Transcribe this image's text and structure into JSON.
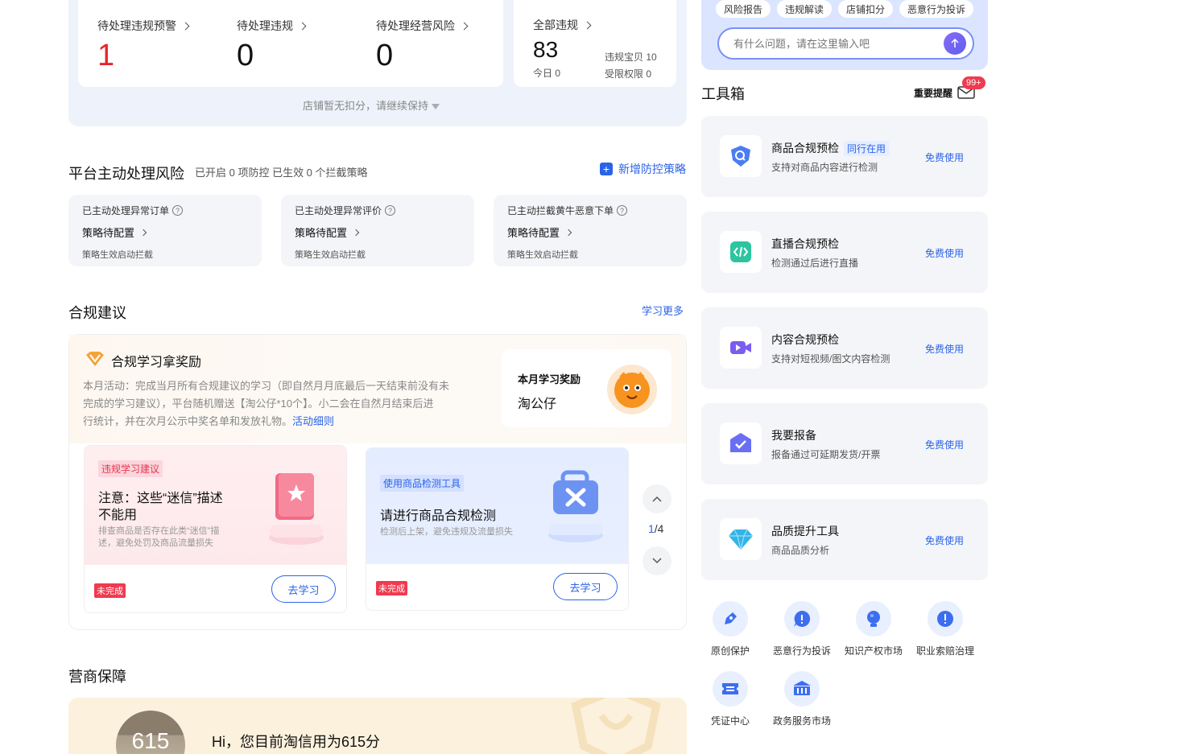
{
  "stats": {
    "pending_warning": {
      "label": "待处理违规预警",
      "value": "1"
    },
    "pending_violation": {
      "label": "待处理违规",
      "value": "0"
    },
    "pending_risk": {
      "label": "待处理经营风险",
      "value": "0"
    },
    "all": {
      "label": "全部违规",
      "value": "83",
      "today": "今日 0",
      "item_violation": "违规宝贝 10",
      "rights_restricted": "受限权限 0"
    },
    "hint": "店铺暂无扣分，请继续保持"
  },
  "risk_section": {
    "title": "平台主动处理风险",
    "subtitle": "已开启 0 项防控 已生效 0 个拦截策略",
    "add_link": "新增防控策略",
    "cards": [
      {
        "title": "已主动处理异常订单",
        "status": "策略待配置",
        "desc": "策略生效启动拦截"
      },
      {
        "title": "已主动处理异常评价",
        "status": "策略待配置",
        "desc": "策略生效启动拦截"
      },
      {
        "title": "已主动拦截黄牛恶意下单",
        "status": "策略待配置",
        "desc": "策略生效启动拦截"
      }
    ]
  },
  "compliance": {
    "title": "合规建议",
    "more_link": "学习更多",
    "reward_title": "合规学习拿奖励",
    "reward_desc_1": "本月活动：完成当月所有合规建议的学习（即自然月月底最后一天结束前没有未",
    "reward_desc_2": "完成的学习建议），平台随机赠送【淘公仔*10个】。小二会在自然月结束后进",
    "reward_desc_3": "行统计，并在次月公示中奖名单和发放礼物。",
    "reward_detail_link": "活动细则",
    "monthly_reward_label": "本月学习奖励",
    "monthly_reward_item": "淘公仔",
    "cards": [
      {
        "tag": "违规学习建议",
        "title_1": "注意：这些“迷信”描述",
        "title_2": "不能用",
        "desc_1": "排查商品是否存在此类“迷信”描",
        "desc_2": "述，避免处罚及商品流量损失",
        "badge": "未完成",
        "button": "去学习"
      },
      {
        "tag": "使用商品检测工具",
        "title_1": "请进行商品合规检测",
        "title_2": "",
        "desc_1": "检测后上架，避免违规及流量损失",
        "desc_2": "",
        "badge": "未完成",
        "button": "去学习"
      }
    ],
    "pager": {
      "current": "1",
      "total": "/4"
    }
  },
  "guarantee": {
    "title": "营商保障",
    "score": "615",
    "greeting": "Hi，您目前淘信用为615分"
  },
  "assistant": {
    "chips": [
      "风险报告",
      "违规解读",
      "店铺扣分",
      "恶意行为投诉"
    ],
    "input_placeholder": "有什么问题，请在这里输入吧"
  },
  "toolbox": {
    "title": "工具箱",
    "reminder_label": "重要提醒",
    "reminder_badge": "99+",
    "tools": [
      {
        "name": "商品合规预检",
        "tag": "同行在用",
        "desc": "支持对商品内容进行检测",
        "action": "免费使用",
        "icon": "shield-search-icon"
      },
      {
        "name": "直播合规预检",
        "tag": "",
        "desc": "检测通过后进行直播",
        "action": "免费使用",
        "icon": "code-icon"
      },
      {
        "name": "内容合规预检",
        "tag": "",
        "desc": "支持对短视频/图文内容检测",
        "action": "免费使用",
        "icon": "video-icon"
      },
      {
        "name": "我要报备",
        "tag": "",
        "desc": "报备通过可延期发货/开票",
        "action": "免费使用",
        "icon": "check-box-icon"
      },
      {
        "name": "品质提升工具",
        "tag": "",
        "desc": "商品品质分析",
        "action": "免费使用",
        "icon": "diamond-icon"
      }
    ],
    "quick": [
      {
        "label": "原创保护",
        "icon": "pen-icon"
      },
      {
        "label": "恶意行为投诉",
        "icon": "alert-icon"
      },
      {
        "label": "知识产权市场",
        "icon": "bulb-icon"
      },
      {
        "label": "职业索赔治理",
        "icon": "alert-icon"
      },
      {
        "label": "凭证中心",
        "icon": "ticket-icon"
      },
      {
        "label": "政务服务市场",
        "icon": "bank-icon"
      }
    ]
  },
  "colors": {
    "accent": "#2b63e8",
    "danger": "#e8242b",
    "panel": "#eef2fb"
  }
}
